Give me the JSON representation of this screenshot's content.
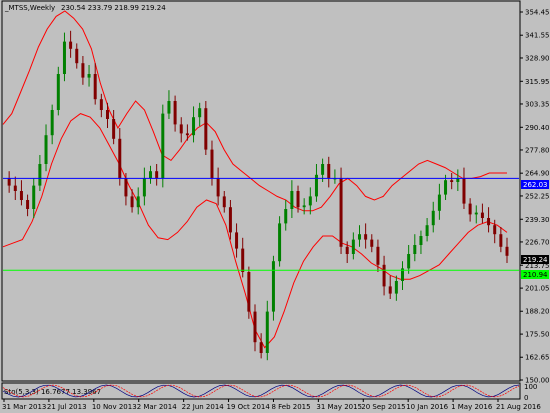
{
  "header": {
    "title": "_MTSS,Weekly",
    "ohlc": "230.54 233.79 218.99 219.24"
  },
  "indicator": {
    "label": "Sto(5,3,3) 16.7677 13.3967",
    "scale_top": "100",
    "scale_bottom": "0"
  },
  "levels": {
    "blue_line": "262.03",
    "green_line": "210.94",
    "last_price": "219.24"
  },
  "colors": {
    "background": "#c0c0c0",
    "candle_up": "#008000",
    "candle_down": "#800000",
    "bands": "#ff0000",
    "blue_line": "#0000ff",
    "green_line": "#00ff00"
  },
  "chart_data": {
    "type": "candlestick",
    "title": "_MTSS,Weekly 230.54 233.79 218.99 219.24",
    "ylim": [
      150,
      360
    ],
    "y_ticks": [
      "354.45",
      "341.55",
      "328.90",
      "315.95",
      "303.35",
      "290.40",
      "277.80",
      "264.90",
      "252.25",
      "239.30",
      "226.70",
      "213.75",
      "201.05",
      "188.20",
      "175.50",
      "162.65",
      "150.00"
    ],
    "x_ticks": [
      "31 Mar 2013",
      "21 Jul 2013",
      "10 Nov 2013",
      "2 Mar 2014",
      "22 Jun 2014",
      "19 Oct 2014",
      "8 Feb 2015",
      "31 May 2015",
      "20 Sep 2015",
      "10 Jan 2016",
      "1 May 2016",
      "21 Aug 2016"
    ],
    "horizontal_lines": [
      {
        "value": 262.03,
        "color": "#0000ff"
      },
      {
        "value": 210.94,
        "color": "#00ff00"
      }
    ],
    "series_approx": [
      {
        "name": "close",
        "values": [
          262,
          258,
          255,
          250,
          245,
          258,
          270,
          286,
          300,
          320,
          338,
          334,
          326,
          318,
          320,
          306,
          300,
          295,
          284,
          262,
          252,
          246,
          252,
          262,
          266,
          262,
          298,
          305,
          292,
          287,
          286,
          296,
          301,
          278,
          262,
          252,
          246,
          232,
          223,
          210,
          188,
          171,
          165,
          188,
          216,
          237,
          245,
          255,
          246,
          247,
          252,
          264,
          270,
          262,
          262,
          224,
          220,
          228,
          231,
          228,
          224,
          214,
          202,
          198,
          205,
          212,
          220,
          225,
          230,
          236,
          244,
          253,
          261,
          260,
          262,
          248,
          242,
          243,
          240,
          236,
          231,
          224,
          219
        ]
      },
      {
        "name": "upper_band",
        "values": [
          292,
          298,
          310,
          322,
          335,
          345,
          352,
          355,
          351,
          345,
          334,
          315,
          300,
          290,
          298,
          305,
          300,
          288,
          275,
          272,
          278,
          285,
          290,
          293,
          288,
          278,
          270,
          266,
          262,
          258,
          255,
          252,
          250,
          246,
          244,
          244,
          246,
          252,
          259,
          262,
          258,
          252,
          250,
          252,
          258,
          262,
          266,
          270,
          272,
          270,
          268,
          265,
          262,
          262,
          263,
          265,
          265,
          265
        ]
      },
      {
        "name": "lower_band",
        "values": [
          224,
          226,
          228,
          238,
          252,
          270,
          284,
          294,
          298,
          296,
          290,
          280,
          270,
          258,
          248,
          236,
          229,
          228,
          232,
          238,
          246,
          250,
          248,
          236,
          216,
          198,
          178,
          168,
          174,
          188,
          204,
          216,
          224,
          230,
          230,
          226,
          224,
          220,
          215,
          212,
          208,
          206,
          206,
          208,
          211,
          214,
          220,
          226,
          232,
          236,
          238,
          236,
          232
        ]
      }
    ]
  }
}
